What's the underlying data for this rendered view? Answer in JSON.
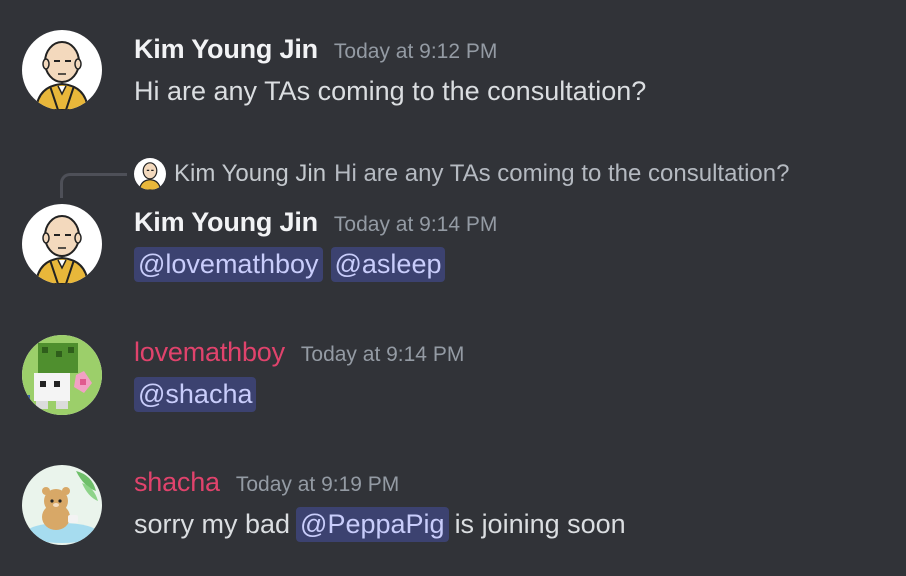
{
  "messages": [
    {
      "author": "Kim Young Jin",
      "timestamp": "Today at 9:12 PM",
      "text": "Hi are any TAs coming to the consultation?"
    },
    {
      "reply_to": {
        "author": "Kim Young Jin",
        "text": "Hi are any TAs coming to the consultation?"
      },
      "author": "Kim Young Jin",
      "timestamp": "Today at 9:14 PM",
      "mentions": [
        "@lovemathboy",
        "@asleep"
      ]
    },
    {
      "author": "lovemathboy",
      "timestamp": "Today at 9:14 PM",
      "mentions": [
        "@shacha"
      ]
    },
    {
      "author": "shacha",
      "timestamp": "Today at 9:19 PM",
      "text_before": "sorry my bad",
      "mention": "@PeppaPig",
      "text_after": "is joining soon"
    }
  ],
  "colors": {
    "background": "#313338",
    "username_default": "#f2f3f5",
    "username_pink": "#e0436c",
    "timestamp": "#949ba4",
    "mention_bg": "#3c4270",
    "mention_text": "#c9cdfb"
  },
  "icons": {
    "kim_avatar": "bald-hero-avatar-icon",
    "lovemathboy_avatar": "pixel-plant-avatar-icon",
    "shacha_avatar": "bear-avatar-icon"
  }
}
